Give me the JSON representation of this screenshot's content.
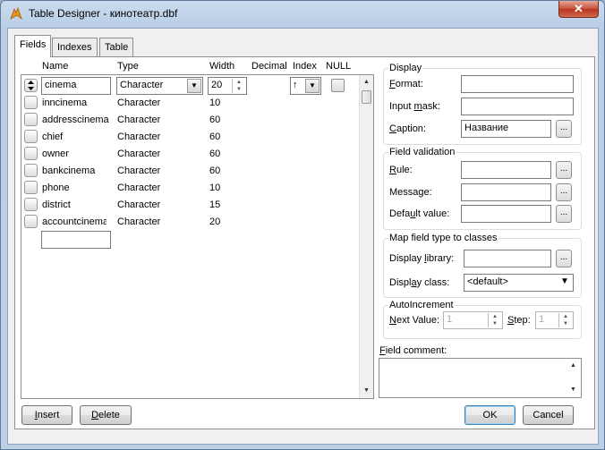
{
  "window": {
    "title": "Table Designer - кинотеатр.dbf",
    "close_label": "✕"
  },
  "tabs": [
    {
      "label": "Fields"
    },
    {
      "label": "Indexes"
    },
    {
      "label": "Table"
    }
  ],
  "grid": {
    "headers": {
      "name": "Name",
      "type": "Type",
      "width": "Width",
      "decimal": "Decimal",
      "index": "Index",
      "null": "NULL"
    },
    "selected_row": {
      "name": "cinema",
      "type": "Character",
      "width": "20",
      "index_arrow": "↑"
    },
    "rows": [
      {
        "name": "inncinema",
        "type": "Character",
        "width": "10"
      },
      {
        "name": "addresscinema",
        "type": "Character",
        "width": "60"
      },
      {
        "name": "chief",
        "type": "Character",
        "width": "60"
      },
      {
        "name": "owner",
        "type": "Character",
        "width": "60"
      },
      {
        "name": "bankcinema",
        "type": "Character",
        "width": "60"
      },
      {
        "name": "phone",
        "type": "Character",
        "width": "10"
      },
      {
        "name": "district",
        "type": "Character",
        "width": "15"
      },
      {
        "name": "accountcinema",
        "type": "Character",
        "width": "20"
      }
    ],
    "new_row_name": ""
  },
  "display": {
    "group_title": "Display",
    "format_label_u": "F",
    "format_label": "ormat:",
    "format_value": "",
    "input_mask_label": "Input ",
    "input_mask_label_u": "m",
    "input_mask_label_rest": "ask:",
    "input_mask_value": "",
    "caption_label_u": "C",
    "caption_label": "aption:",
    "caption_value": "Название",
    "ellipsis": "..."
  },
  "validation": {
    "group_title": "Field validation",
    "rule_label_u": "R",
    "rule_label": "ule:",
    "rule_value": "",
    "message_label": "Message:",
    "message_value": "",
    "default_label_pre": "Defa",
    "default_label_u": "u",
    "default_label_rest": "lt value:",
    "default_value": "",
    "ellipsis": "..."
  },
  "mapping": {
    "group_title": "Map field type to classes",
    "library_label_pre": "Display ",
    "library_label_u": "l",
    "library_label_rest": "ibrary:",
    "library_value": "",
    "class_label_pre": "Displ",
    "class_label_u": "a",
    "class_label_rest": "y class:",
    "class_value": "<default>",
    "ellipsis": "..."
  },
  "autoincrement": {
    "group_title": "AutoIncrement",
    "next_label_u": "N",
    "next_label": "ext Value:",
    "next_value": "1",
    "step_label_u": "S",
    "step_label": "tep:",
    "step_value": "1"
  },
  "comment": {
    "label_u": "F",
    "label": "ield comment:",
    "value": ""
  },
  "buttons": {
    "insert_u": "I",
    "insert": "nsert",
    "delete_u": "D",
    "delete": "elete",
    "ok": "OK",
    "cancel": "Cancel"
  }
}
